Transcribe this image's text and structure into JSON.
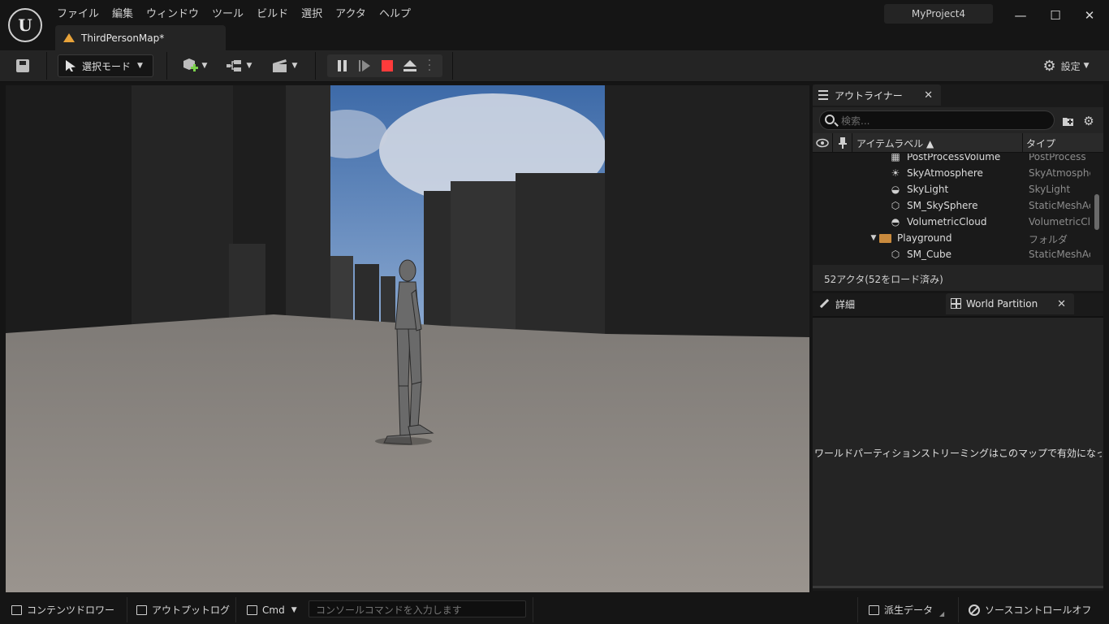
{
  "app": {
    "logo": "U",
    "menu": [
      "ファイル",
      "編集",
      "ウィンドウ",
      "ツール",
      "ビルド",
      "選択",
      "アクタ",
      "ヘルプ"
    ],
    "project_name": "MyProject4",
    "window_controls": {
      "minimize": "—",
      "maximize": "☐",
      "close": "✕"
    },
    "document_tab": {
      "label": "ThirdPersonMap*",
      "icon": "level-icon"
    }
  },
  "toolbar": {
    "mode_label": "選択モード",
    "settings_label": "設定",
    "icons": [
      "save-icon",
      "add-actor-icon",
      "blueprint-icon",
      "cinematics-icon",
      "pause-icon",
      "step-frame-icon",
      "stop-icon",
      "eject-icon",
      "more-options-icon",
      "settings-gear-icon"
    ],
    "colors": {
      "stop": "#ff3b3b",
      "add": "#7bd14b"
    }
  },
  "outliner": {
    "tab_label": "アウトライナー",
    "search_placeholder": "検索...",
    "columns": {
      "label": "アイテムラベル ▲",
      "type": "タイプ"
    },
    "rows": [
      {
        "label": "PostProcessVolume",
        "type": "PostProcess",
        "icon": "postprocess-icon",
        "indent": 2
      },
      {
        "label": "SkyAtmosphere",
        "type": "SkyAtmosphe",
        "icon": "sky-atmosphere-icon",
        "indent": 2
      },
      {
        "label": "SkyLight",
        "type": "SkyLight",
        "icon": "skylight-icon",
        "indent": 2
      },
      {
        "label": "SM_SkySphere",
        "type": "StaticMeshAc",
        "icon": "static-mesh-icon",
        "indent": 2
      },
      {
        "label": "VolumetricCloud",
        "type": "VolumetricClo",
        "icon": "volumetric-cloud-icon",
        "indent": 2
      },
      {
        "label": "Playground",
        "type": "フォルダ",
        "icon": "folder-icon",
        "indent": 1
      },
      {
        "label": "SM_Cube",
        "type": "StaticMeshAc",
        "icon": "static-mesh-icon",
        "indent": 2
      }
    ],
    "actor_count": "52アクタ(52をロード済み)"
  },
  "details": {
    "tab_details": "詳細",
    "tab_world_partition": "World Partition",
    "message": "ワールドパーティションストリーミングはこのマップで有効になっていません。"
  },
  "statusbar": {
    "content_drawer": "コンテンツドロワー",
    "output_log": "アウトプットログ",
    "cmd": "Cmd",
    "console_placeholder": "コンソールコマンドを入力します",
    "derived_data": "派生データ",
    "source_control": "ソースコントロールオフ"
  }
}
